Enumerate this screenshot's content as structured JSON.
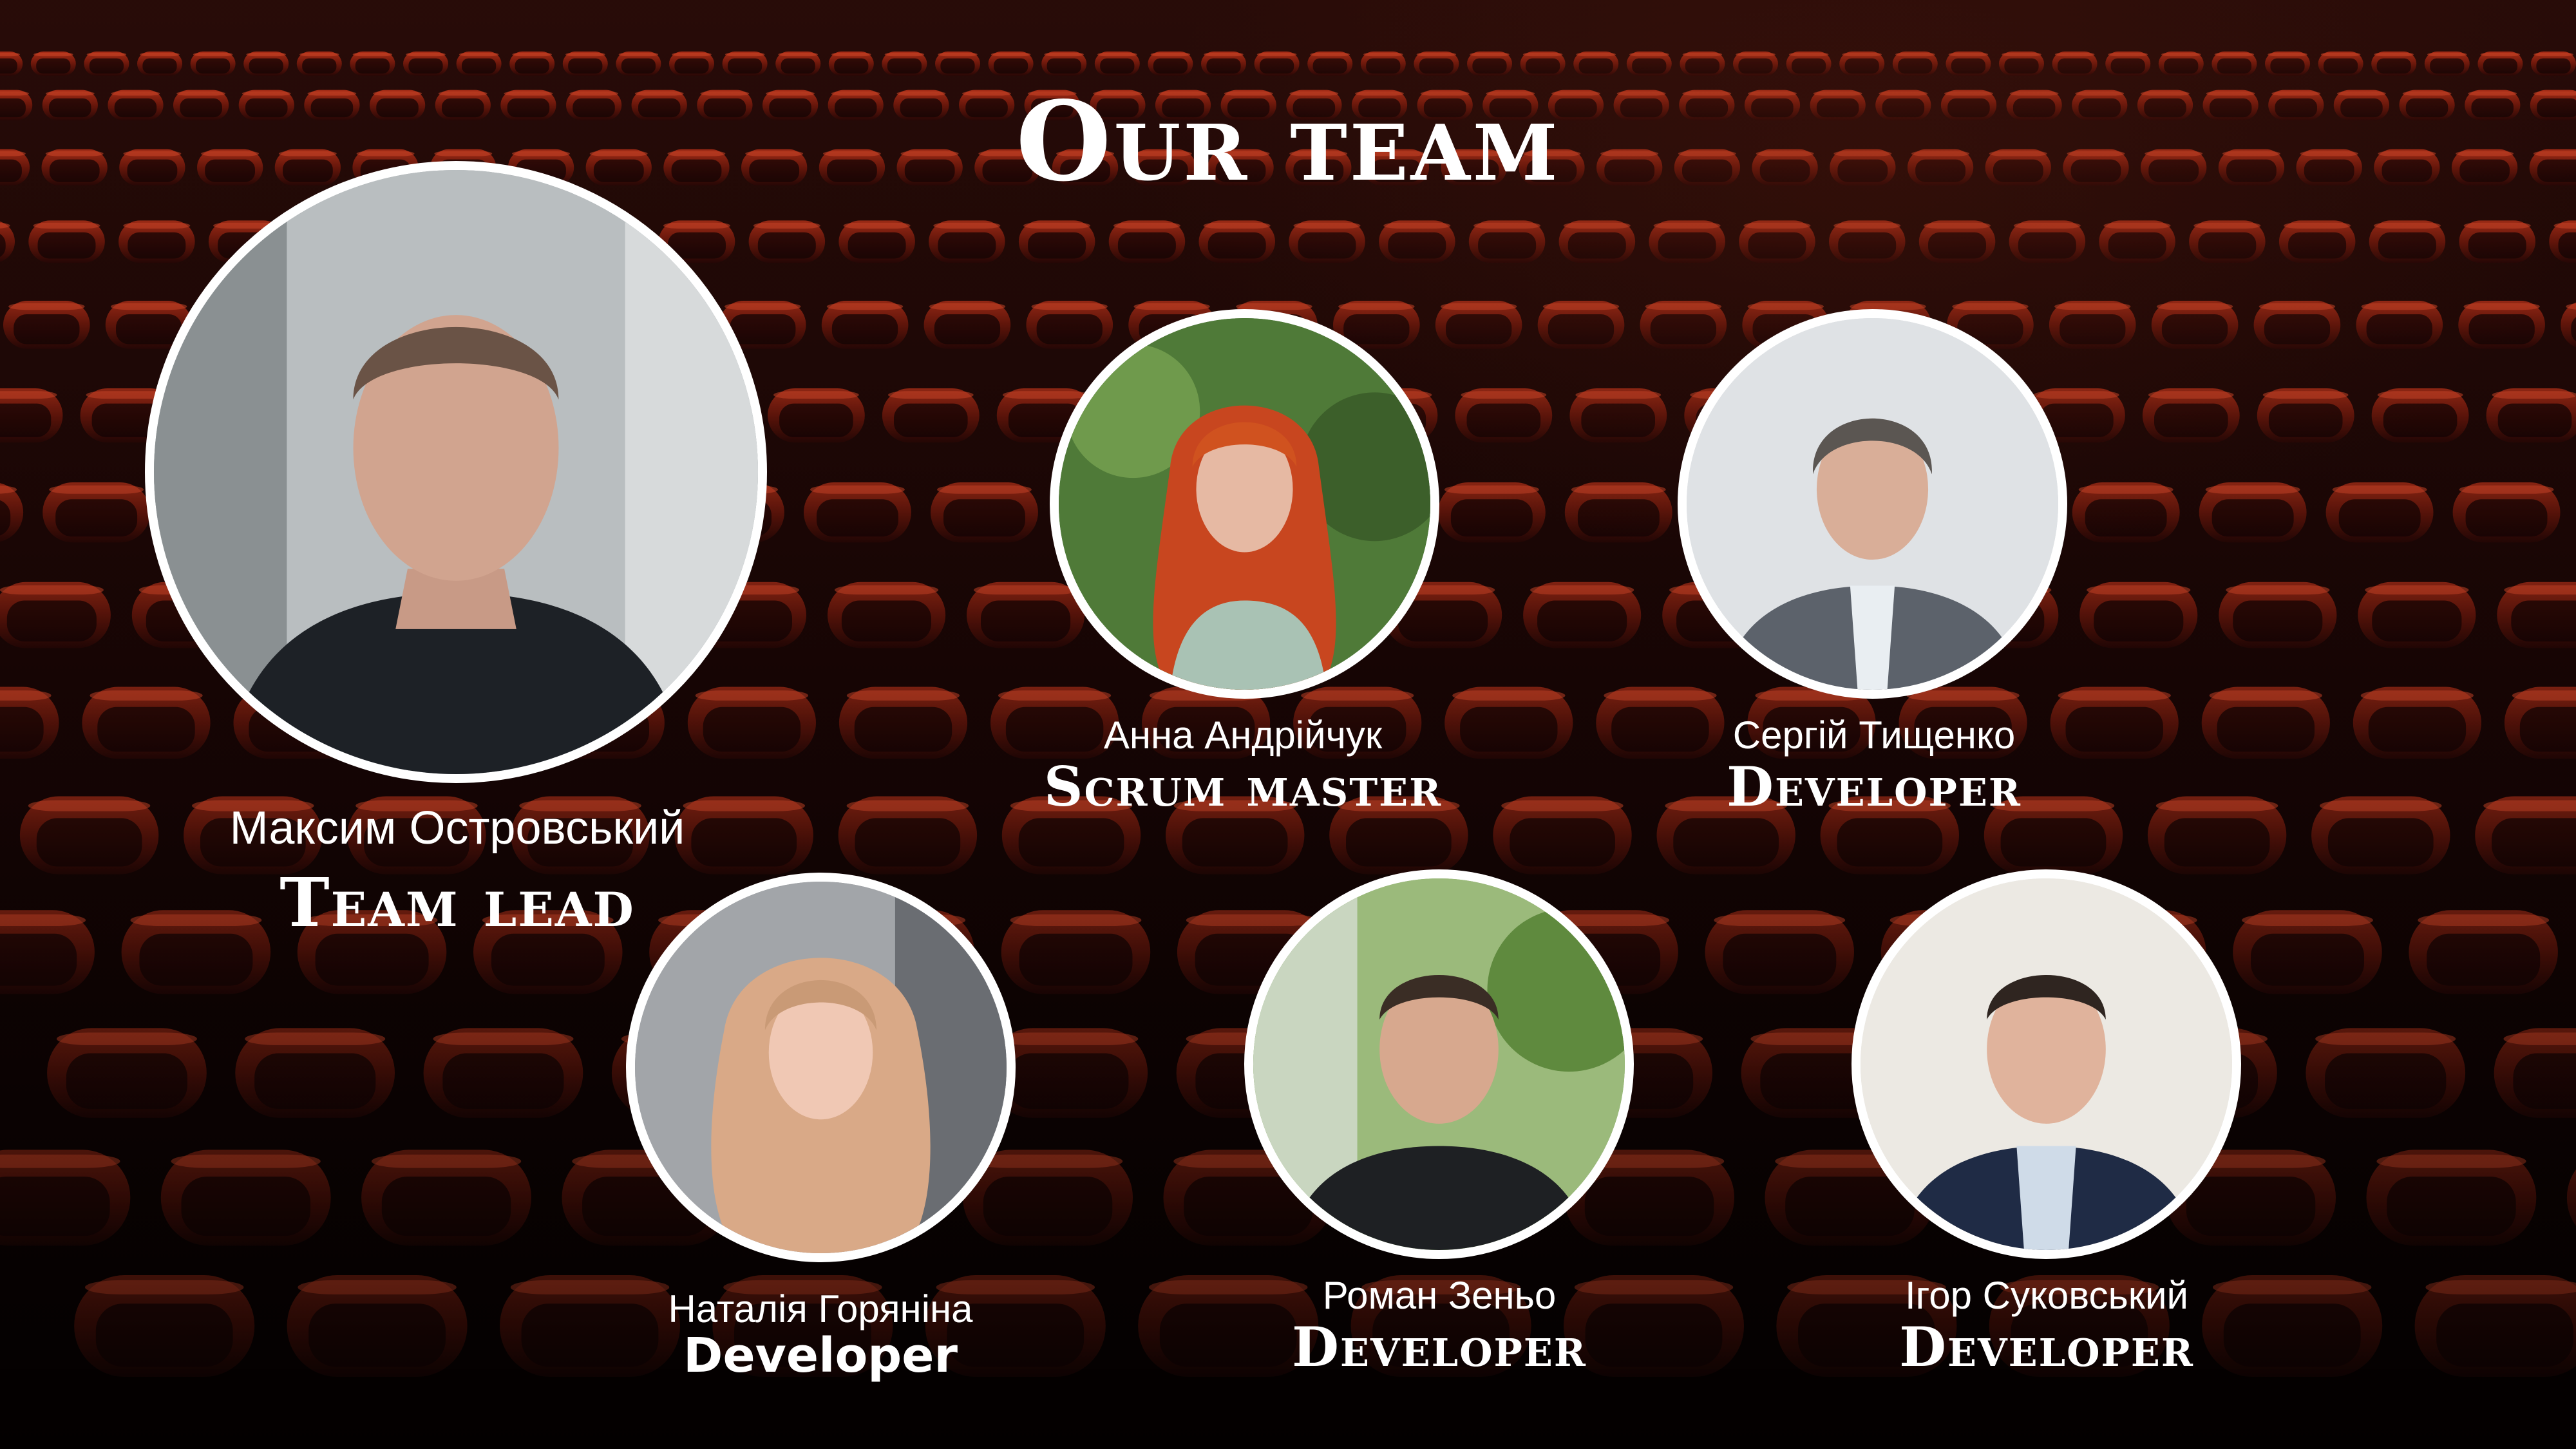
{
  "slide": {
    "title": "Our team"
  },
  "team": [
    {
      "name": "Максим Островський",
      "role": "Team lead",
      "photo_icon": "person-icon"
    },
    {
      "name": "Анна Андрійчук",
      "role": "Scrum master",
      "photo_icon": "person-icon"
    },
    {
      "name": "Сергій Тищенко",
      "role": "Developer",
      "photo_icon": "person-icon"
    },
    {
      "name": "Наталія Горяніна",
      "role": "Developer",
      "photo_icon": "person-icon"
    },
    {
      "name": "Роман Зеньо",
      "role": "Developer",
      "photo_icon": "person-icon"
    },
    {
      "name": "Ігор Суковський",
      "role": "Developer",
      "photo_icon": "person-icon"
    }
  ],
  "colors": {
    "text": "#ffffff",
    "photo_border": "#ffffff",
    "seat_red": "#b52a14",
    "background": "#120405"
  }
}
